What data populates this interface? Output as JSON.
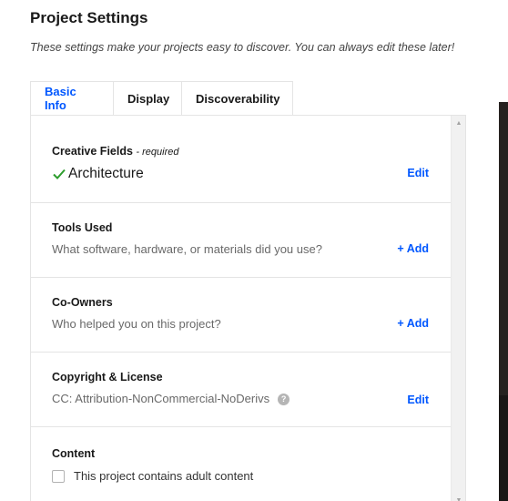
{
  "header": {
    "title": "Project Settings",
    "subtitle": "These settings make your projects easy to discover. You can always edit these later!"
  },
  "tabs": [
    {
      "label": "Basic Info",
      "active": true
    },
    {
      "label": "Display",
      "active": false
    },
    {
      "label": "Discoverability",
      "active": false
    }
  ],
  "sections": {
    "creative_fields": {
      "label": "Creative Fields",
      "required_note": "- required",
      "value": "Architecture",
      "action": "Edit"
    },
    "tools_used": {
      "label": "Tools Used",
      "description": "What software, hardware, or materials did you use?",
      "action": "+ Add"
    },
    "co_owners": {
      "label": "Co-Owners",
      "description": "Who helped you on this project?",
      "action": "+ Add"
    },
    "copyright": {
      "label": "Copyright & License",
      "description": "CC: Attribution-NonCommercial-NoDerivs",
      "info_icon": "?",
      "action": "Edit"
    },
    "content": {
      "label": "Content",
      "checkbox_label": "This project contains adult content",
      "checked": false
    }
  },
  "colors": {
    "accent": "#0057ff",
    "check": "#2d9d2d",
    "border": "#e4e4e4"
  }
}
